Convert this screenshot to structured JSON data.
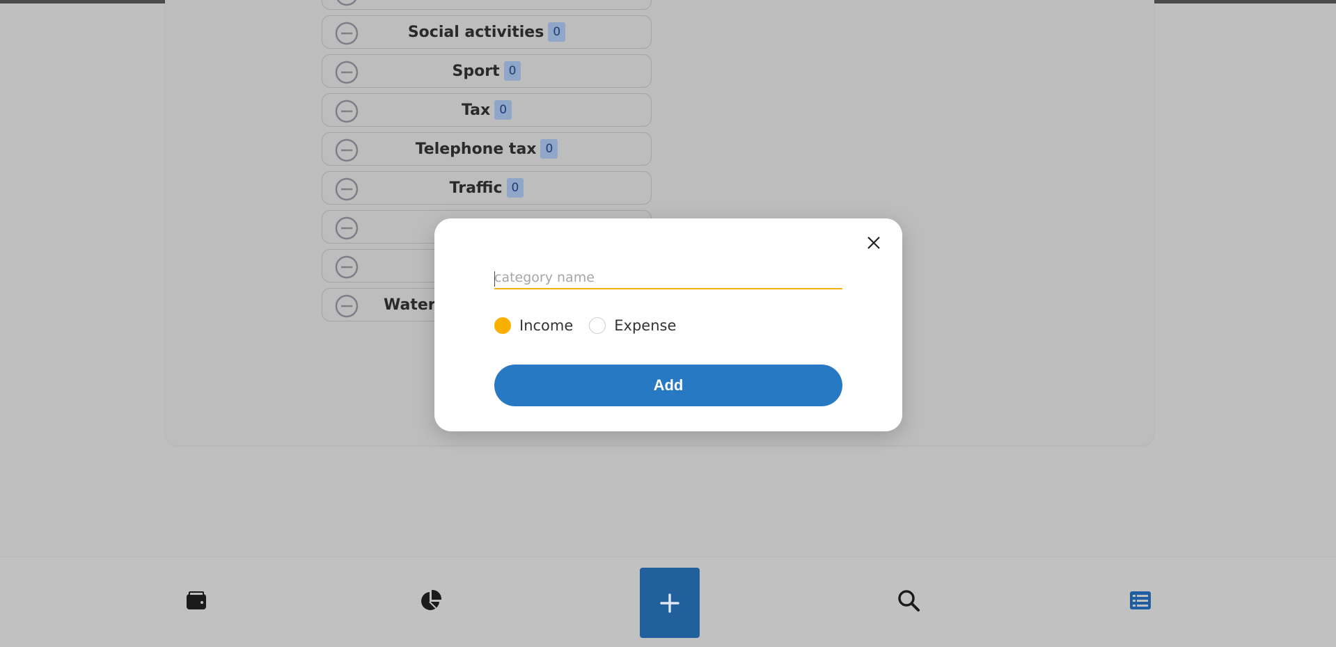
{
  "categories": [
    {
      "name": "Social activities",
      "count": "0"
    },
    {
      "name": "Sport",
      "count": "0"
    },
    {
      "name": "Tax",
      "count": "0"
    },
    {
      "name": "Telephone tax",
      "count": "0"
    },
    {
      "name": "Traffic",
      "count": "0"
    },
    {
      "name": "",
      "count": ""
    },
    {
      "name": "",
      "count": ""
    },
    {
      "name": "Water a",
      "count": ""
    }
  ],
  "modal": {
    "input_placeholder": "category name",
    "input_value": "",
    "radio_income": "Income",
    "radio_expense": "Expense",
    "selected_type": "income",
    "add_button": "Add"
  },
  "nav": {
    "items": [
      "wallet-icon",
      "pie-chart-icon",
      "plus-icon",
      "search-icon",
      "list-icon"
    ],
    "active": "list-icon"
  },
  "colors": {
    "accent_yellow": "#f9b002",
    "primary_blue": "#2779c4",
    "nav_active": "#1f5fa1",
    "badge_bg": "#8fa6c9"
  }
}
